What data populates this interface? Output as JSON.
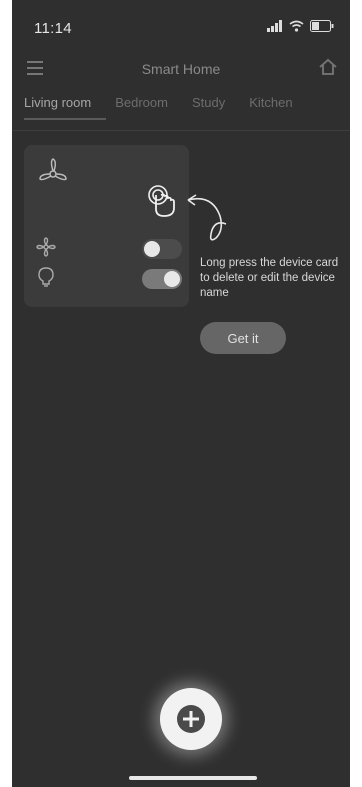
{
  "status_bar": {
    "time": "11:14"
  },
  "header": {
    "title": "Smart Home"
  },
  "tabs": [
    {
      "label": "Living room",
      "active": true
    },
    {
      "label": "Bedroom",
      "active": false
    },
    {
      "label": "Study",
      "active": false
    },
    {
      "label": "Kitchen",
      "active": false
    }
  ],
  "device_card": {
    "icons": {
      "device": "ceiling-fan-icon",
      "gesture": "long-press-hand-icon",
      "row1": "fan-icon",
      "row2": "bulb-icon"
    },
    "row1_toggle_on": false,
    "row2_toggle_on": true
  },
  "guide": {
    "hint": "Long press the device card to delete or edit the device name",
    "button_label": "Get it"
  },
  "fab": {
    "icon": "plus-icon"
  },
  "colors": {
    "background": "#2f2f2f",
    "card": "#3b3b3b",
    "button": "#666666"
  }
}
